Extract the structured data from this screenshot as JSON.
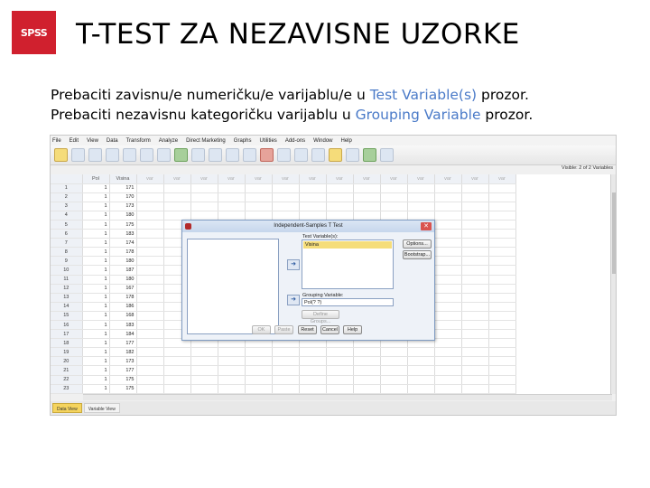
{
  "slide": {
    "logo": "SPSS",
    "title": "T-TEST ZA NEZAVISNE UZORKE",
    "line1_pre": "Prebaciti zavisnu/e numeričku/e varijablu/e u ",
    "line1_hl": "Test Variable(s)",
    "line1_post": " prozor.",
    "line2_pre": "Prebaciti nezavisnu kategoričku varijablu u ",
    "line2_hl": "Grouping Variable",
    "line2_post": " prozor."
  },
  "spss": {
    "menu": [
      "File",
      "Edit",
      "View",
      "Data",
      "Transform",
      "Analyze",
      "Direct Marketing",
      "Graphs",
      "Utilities",
      "Add-ons",
      "Window",
      "Help"
    ],
    "visible_text": "Visible: 2 of 2 Variables",
    "columns": [
      "Pol",
      "Visina",
      "var",
      "var",
      "var",
      "var",
      "var",
      "var",
      "var",
      "var",
      "var",
      "var",
      "var",
      "var",
      "var",
      "var"
    ],
    "rows": [
      [
        "1",
        "1",
        "171"
      ],
      [
        "2",
        "1",
        "170"
      ],
      [
        "3",
        "1",
        "173"
      ],
      [
        "4",
        "1",
        "180"
      ],
      [
        "5",
        "1",
        "175"
      ],
      [
        "6",
        "1",
        "183"
      ],
      [
        "7",
        "1",
        "174"
      ],
      [
        "8",
        "1",
        "178"
      ],
      [
        "9",
        "1",
        "180"
      ],
      [
        "10",
        "1",
        "187"
      ],
      [
        "11",
        "1",
        "180"
      ],
      [
        "12",
        "1",
        "167"
      ],
      [
        "13",
        "1",
        "178"
      ],
      [
        "14",
        "1",
        "186"
      ],
      [
        "15",
        "1",
        "168"
      ],
      [
        "16",
        "1",
        "183"
      ],
      [
        "17",
        "1",
        "184"
      ],
      [
        "18",
        "1",
        "177"
      ],
      [
        "19",
        "1",
        "182"
      ],
      [
        "20",
        "1",
        "173"
      ],
      [
        "21",
        "1",
        "177"
      ],
      [
        "22",
        "1",
        "175"
      ],
      [
        "23",
        "1",
        "175"
      ]
    ],
    "tabs": [
      "Data View",
      "Variable View"
    ],
    "dialog": {
      "title": "Independent-Samples T Test",
      "test_label": "Test Variable(s):",
      "test_item": "Visina",
      "group_label": "Grouping Variable:",
      "group_value": "Pol(? ?)",
      "define_groups": "Define Groups...",
      "options": "Options...",
      "bootstrap": "Bootstrap...",
      "ok": "OK",
      "paste": "Paste",
      "reset": "Reset",
      "cancel": "Cancel",
      "help": "Help"
    }
  }
}
